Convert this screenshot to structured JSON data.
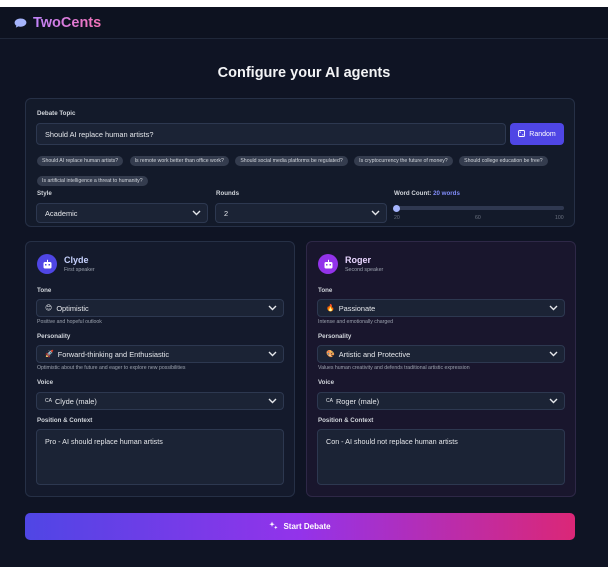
{
  "app": {
    "brand": "TwoCents"
  },
  "heading": "Configure your AI agents",
  "topic": {
    "label": "Debate Topic",
    "value": "Should AI replace human artists?",
    "random_label": "Random",
    "suggestions": [
      "Should AI replace human artists?",
      "Is remote work better than office work?",
      "Should social media platforms be regulated?",
      "Is cryptocurrency the future of money?",
      "Should college education be free?",
      "Is artificial intelligence a threat to humanity?"
    ]
  },
  "settings": {
    "style_label": "Style",
    "style_value": "Academic",
    "rounds_label": "Rounds",
    "rounds_value": "2",
    "word_count_label": "Word Count:",
    "word_count_value": "20 words",
    "slider_min": "20",
    "slider_mid": "60",
    "slider_max": "100",
    "slider_fraction": 0.0
  },
  "agents": [
    {
      "name": "Clyde",
      "role": "First speaker",
      "tone_label": "Tone",
      "tone_value": "Optimistic",
      "tone_emoji": "😊",
      "tone_hint": "Positive and hopeful outlook",
      "personality_label": "Personality",
      "personality_value": "Forward-thinking and Enthusiastic",
      "personality_emoji": "🚀",
      "personality_hint": "Optimistic about the future and eager to explore new possibilities",
      "voice_label": "Voice",
      "voice_value": "Clyde (male)",
      "voice_prefix": "CA",
      "position_label": "Position & Context",
      "position_value": "Pro - AI should replace human artists",
      "accent": "#6366f1"
    },
    {
      "name": "Roger",
      "role": "Second speaker",
      "tone_label": "Tone",
      "tone_value": "Passionate",
      "tone_emoji": "🔥",
      "tone_hint": "Intense and emotionally charged",
      "personality_label": "Personality",
      "personality_value": "Artistic and Protective",
      "personality_emoji": "🎨",
      "personality_hint": "Values human creativity and defends traditional artistic expression",
      "voice_label": "Voice",
      "voice_value": "Roger (male)",
      "voice_prefix": "CA",
      "position_label": "Position & Context",
      "position_value": "Con - AI should not replace human artists",
      "accent": "#a855f7"
    }
  ],
  "start_label": "Start Debate",
  "icons": {
    "logo": "chat-bubble-icon",
    "random": "dice-icon",
    "avatar": "robot-icon",
    "start": "sparkles-icon",
    "dropdown": "chevron-down-icon"
  }
}
